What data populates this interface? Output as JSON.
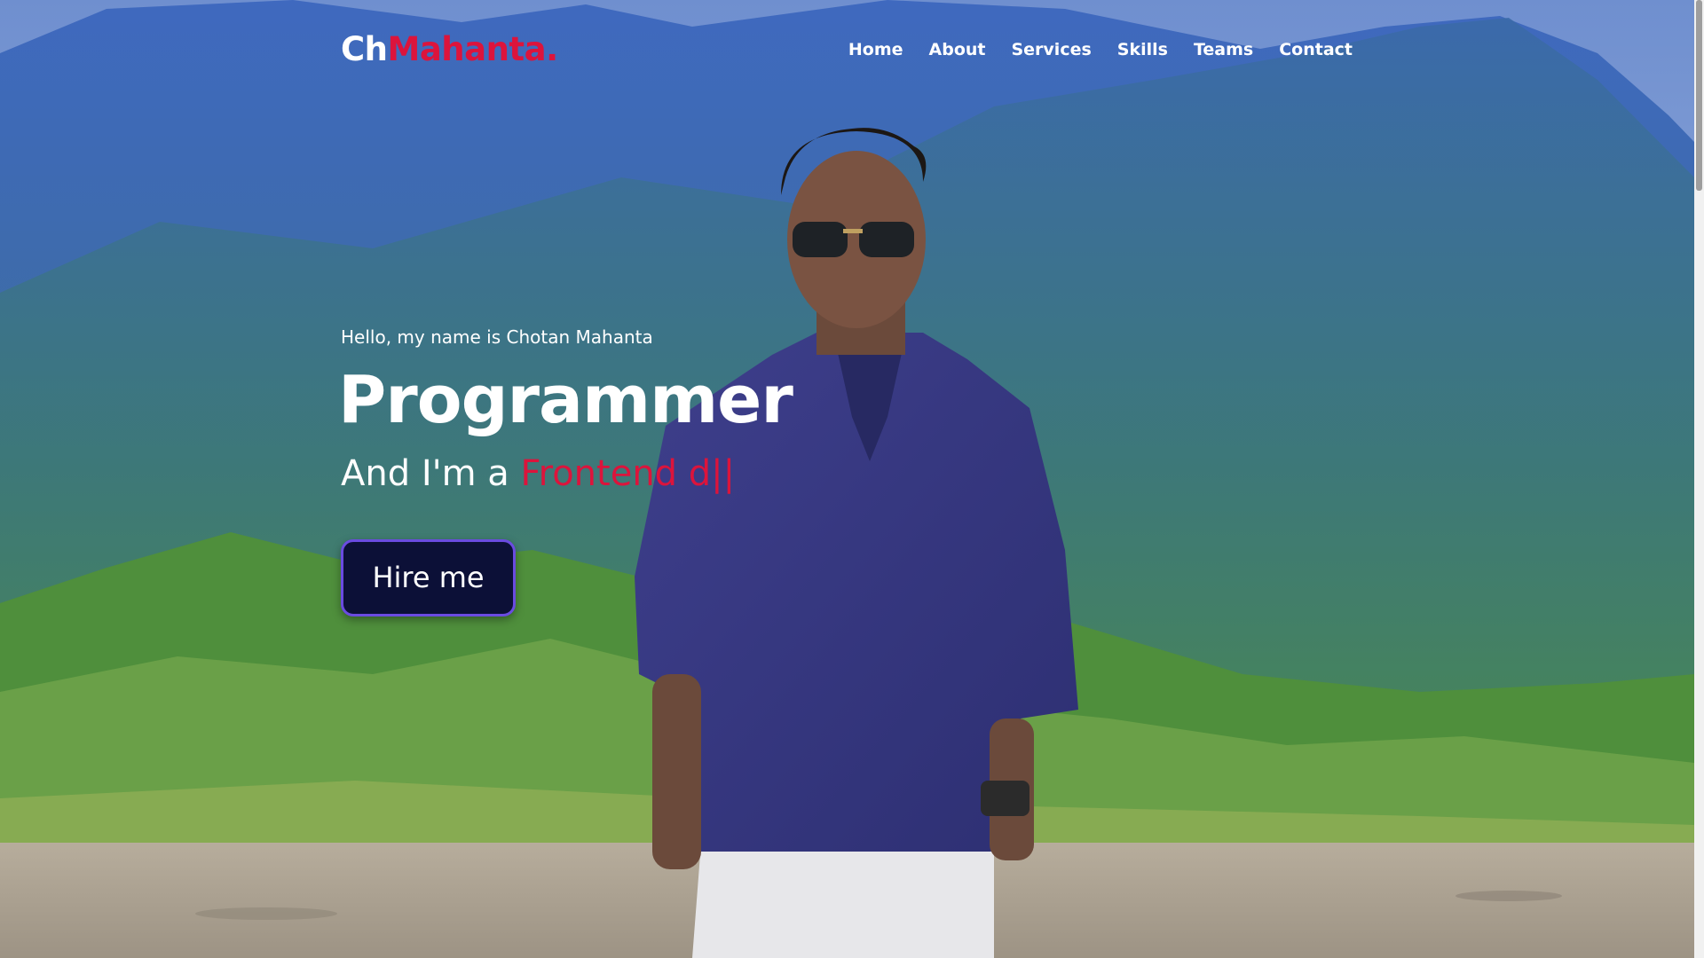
{
  "nav": {
    "logo_prefix": "Ch",
    "logo_highlight": "Mahanta.",
    "items": [
      {
        "label": "Home"
      },
      {
        "label": "About"
      },
      {
        "label": "Services"
      },
      {
        "label": "Skills"
      },
      {
        "label": "Teams"
      },
      {
        "label": "Contact"
      }
    ]
  },
  "hero": {
    "greeting": "Hello, my name is Chotan Mahanta",
    "title": "Programmer",
    "subtitle_prefix": "And I'm a ",
    "typed_text": "Frontend d",
    "cursor": "||",
    "cta_label": "Hire me"
  },
  "colors": {
    "accent": "#dc143c",
    "button_bg": "#0c1037",
    "button_border": "#6a4be0"
  }
}
